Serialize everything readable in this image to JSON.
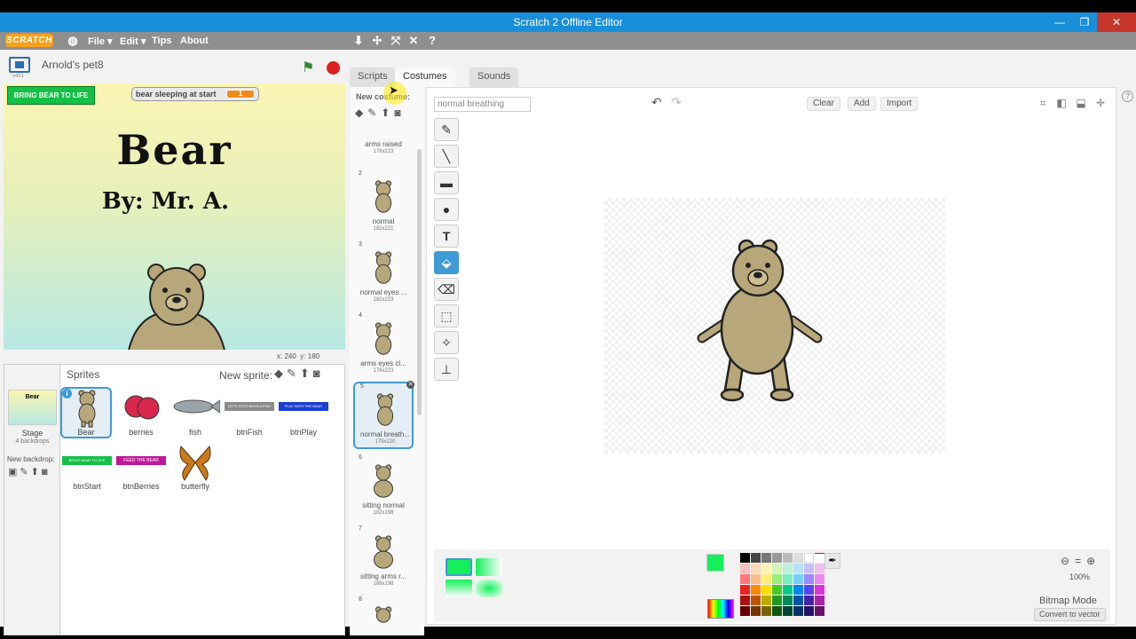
{
  "window": {
    "title": "Scratch 2 Offline Editor"
  },
  "menubar": {
    "logo": "SCRATCH",
    "items": [
      "File ▾",
      "Edit ▾",
      "Tips",
      "About"
    ],
    "tool_icons": [
      "duplicate-icon",
      "cut-icon",
      "grow-icon",
      "shrink-icon",
      "help-icon"
    ]
  },
  "stage_header": {
    "version": "v451",
    "project_name": "Arnold's pet8"
  },
  "stage": {
    "button_label": "BRING BEAR TO LIFE",
    "monitor_label": "bear sleeping at start",
    "monitor_value": "1",
    "title": "Bear",
    "subtitle": "By: Mr. A."
  },
  "coords": {
    "x_label": "x:",
    "x": "240",
    "y_label": "y:",
    "y": "180"
  },
  "sprites_panel": {
    "title": "Sprites",
    "new_sprite_label": "New sprite:",
    "stage_label": "Stage",
    "stage_sub": "4 backdrops",
    "stage_thumb_text": "Bear",
    "new_backdrop_label": "New backdrop:",
    "sprites": [
      {
        "name": "Bear"
      },
      {
        "name": "berries"
      },
      {
        "name": "fish"
      },
      {
        "name": "btnFish",
        "thumb_text": "LET'S FEED BEAR A FISH"
      },
      {
        "name": "btnPlay",
        "thumb_text": "PLAY WITH THE BEAR"
      },
      {
        "name": "btnStart",
        "thumb_text": "BRING BEAR TO LIFE"
      },
      {
        "name": "btnBerries",
        "thumb_text": "FEED THE BEAR"
      },
      {
        "name": "butterfly"
      }
    ]
  },
  "tabs": [
    "Scripts",
    "Costumes",
    "Sounds"
  ],
  "costumes_panel": {
    "new_costume_label": "New costume:",
    "costumes": [
      {
        "num": "",
        "name": "arms raised",
        "size": "178x223"
      },
      {
        "num": "2",
        "name": "normal",
        "size": "182x221"
      },
      {
        "num": "3",
        "name": "normal eyes ...",
        "size": "182x223"
      },
      {
        "num": "4",
        "name": "arms eyes cl...",
        "size": "178x223"
      },
      {
        "num": "5",
        "name": "normal breath...",
        "size": "179x220"
      },
      {
        "num": "6",
        "name": "sitting normal",
        "size": "182x198"
      },
      {
        "num": "7",
        "name": "sitting arms r...",
        "size": "189x198"
      },
      {
        "num": "8",
        "name": "",
        "size": ""
      }
    ]
  },
  "editor": {
    "costume_name": "normal breathing",
    "buttons": {
      "clear": "Clear",
      "add": "Add",
      "import": "Import"
    },
    "zoom": "100%",
    "mode": "Bitmap Mode",
    "convert": "Convert to vector",
    "current_color": "#14f05a"
  }
}
